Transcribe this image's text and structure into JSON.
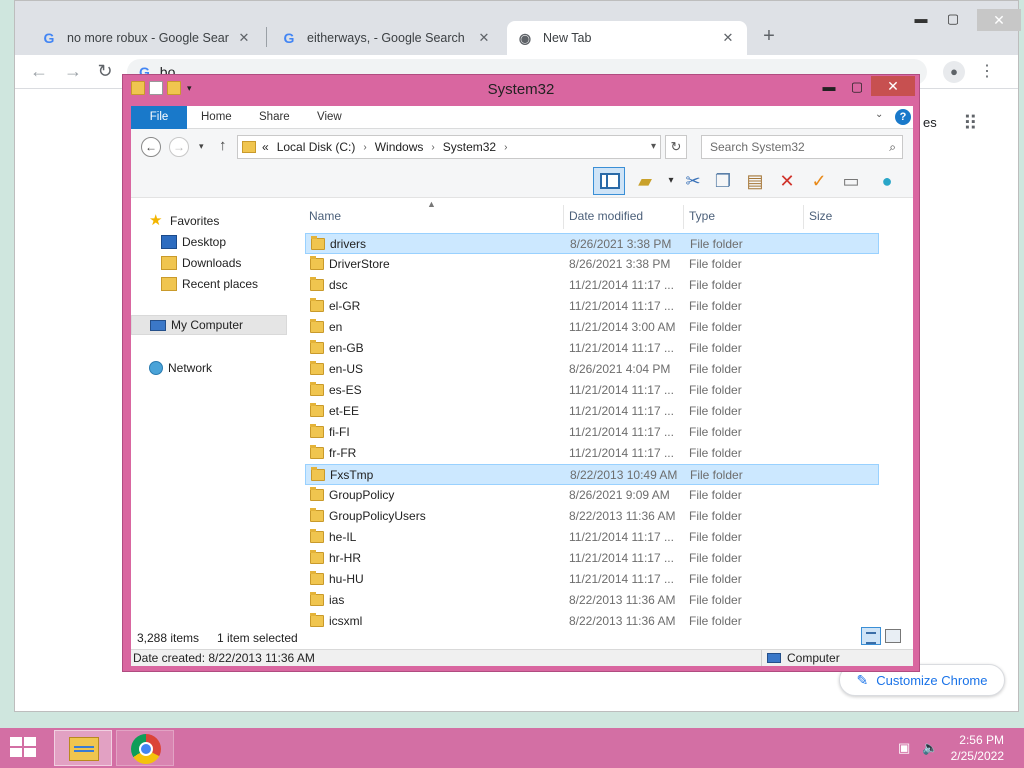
{
  "chrome": {
    "tabs": [
      {
        "title": "no more robux - Google Search",
        "favicon": "google-g-icon"
      },
      {
        "title": "eitherways, - Google Search",
        "favicon": "google-g-icon"
      },
      {
        "title": "New Tab",
        "favicon": "chrome-icon"
      }
    ],
    "omnibox_text": "bo",
    "ntp_images_label": "es",
    "customize_label": "Customize Chrome"
  },
  "explorer": {
    "title": "System32",
    "ribbon_tabs": [
      "File",
      "Home",
      "Share",
      "View"
    ],
    "breadcrumb": {
      "overflow": "«",
      "parts": [
        "Local Disk (C:)",
        "Windows",
        "System32"
      ]
    },
    "search_placeholder": "Search System32",
    "nav": {
      "favorites": "Favorites",
      "desktop": "Desktop",
      "downloads": "Downloads",
      "recent": "Recent places",
      "computer": "My Computer",
      "network": "Network"
    },
    "columns": {
      "name": "Name",
      "date": "Date modified",
      "type": "Type",
      "size": "Size"
    },
    "files": [
      {
        "name": "drivers",
        "date": "8/26/2021 3:38 PM",
        "type": "File folder",
        "selected": true
      },
      {
        "name": "DriverStore",
        "date": "8/26/2021 3:38 PM",
        "type": "File folder"
      },
      {
        "name": "dsc",
        "date": "11/21/2014 11:17 ...",
        "type": "File folder"
      },
      {
        "name": "el-GR",
        "date": "11/21/2014 11:17 ...",
        "type": "File folder"
      },
      {
        "name": "en",
        "date": "11/21/2014 3:00 AM",
        "type": "File folder"
      },
      {
        "name": "en-GB",
        "date": "11/21/2014 11:17 ...",
        "type": "File folder"
      },
      {
        "name": "en-US",
        "date": "8/26/2021 4:04 PM",
        "type": "File folder"
      },
      {
        "name": "es-ES",
        "date": "11/21/2014 11:17 ...",
        "type": "File folder"
      },
      {
        "name": "et-EE",
        "date": "11/21/2014 11:17 ...",
        "type": "File folder"
      },
      {
        "name": "fi-FI",
        "date": "11/21/2014 11:17 ...",
        "type": "File folder"
      },
      {
        "name": "fr-FR",
        "date": "11/21/2014 11:17 ...",
        "type": "File folder"
      },
      {
        "name": "FxsTmp",
        "date": "8/22/2013 10:49 AM",
        "type": "File folder",
        "selected": true
      },
      {
        "name": "GroupPolicy",
        "date": "8/26/2021 9:09 AM",
        "type": "File folder"
      },
      {
        "name": "GroupPolicyUsers",
        "date": "8/22/2013 11:36 AM",
        "type": "File folder"
      },
      {
        "name": "he-IL",
        "date": "11/21/2014 11:17 ...",
        "type": "File folder"
      },
      {
        "name": "hr-HR",
        "date": "11/21/2014 11:17 ...",
        "type": "File folder"
      },
      {
        "name": "hu-HU",
        "date": "11/21/2014 11:17 ...",
        "type": "File folder"
      },
      {
        "name": "ias",
        "date": "8/22/2013 11:36 AM",
        "type": "File folder"
      },
      {
        "name": "icsxml",
        "date": "8/22/2013 11:36 AM",
        "type": "File folder"
      }
    ],
    "status": {
      "item_count": "3,288 items",
      "selected": "1 item selected"
    },
    "details": {
      "date_created": "Date created: 8/22/2013 11:36 AM",
      "location": "Computer"
    }
  },
  "taskbar": {
    "time": "2:56 PM",
    "date": "2/25/2022"
  },
  "colors": {
    "accent_ribbon_file": "#1979ca",
    "window_frame": "#d966a0",
    "taskbar": "#d36fa4",
    "selection": "#cce8ff"
  }
}
